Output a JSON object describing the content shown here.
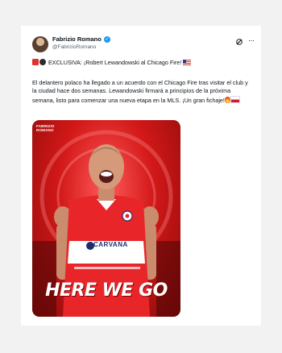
{
  "tweet": {
    "author_name": "Fabrizio Romano",
    "author_handle": "@FabrizioRomano",
    "verified_glyph": "✓",
    "headline": "EXCLUSIVA: ¡Robert Lewandowski al Chicago Fire!",
    "body": "El delantero polaco ha llegado a un acuerdo con el Chicago Fire tras visitar el club y la ciudad hace dos semanas. Lewandowski firmará a principios de la próxima semana, listo para comenzar una nueva etapa en la MLS. ¡Un gran fichaje!",
    "more_glyph": "···"
  },
  "poster": {
    "brand_line1": "FABRIZIO",
    "brand_line2": "ROMANO",
    "sponsor": "CARVANA",
    "slogan": "HERE WE GO"
  },
  "icons": {
    "verified": "verified-badge-icon",
    "grok": "grok-icon",
    "more": "more-options-icon",
    "siren": "siren-emoji-icon",
    "bomb": "bomb-emoji-icon",
    "flag_us": "us-flag-emoji-icon",
    "fire": "fire-emoji-icon",
    "flag_pl": "poland-flag-emoji-icon"
  },
  "colors": {
    "verified_blue": "#1d9bf0",
    "poster_red": "#d31818",
    "text_primary": "#0f1419",
    "text_secondary": "#536471"
  }
}
